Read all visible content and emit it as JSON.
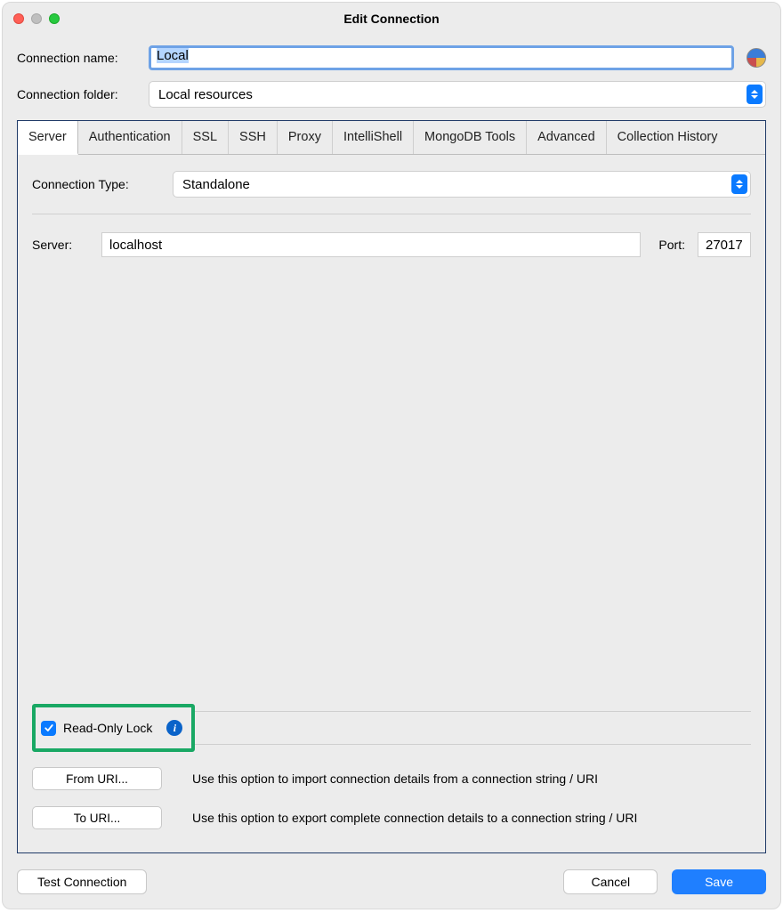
{
  "window": {
    "title": "Edit Connection"
  },
  "form": {
    "name_label": "Connection name:",
    "name_value": "Local",
    "folder_label": "Connection folder:",
    "folder_value": "Local resources"
  },
  "tabs": {
    "server": "Server",
    "authentication": "Authentication",
    "ssl": "SSL",
    "ssh": "SSH",
    "proxy": "Proxy",
    "intellishell": "IntelliShell",
    "mongodb_tools": "MongoDB Tools",
    "advanced": "Advanced",
    "collection_history": "Collection History"
  },
  "server_tab": {
    "ctype_label": "Connection Type:",
    "ctype_value": "Standalone",
    "server_label": "Server:",
    "server_value": "localhost",
    "port_label": "Port:",
    "port_value": "27017",
    "readonly_label": "Read-Only Lock",
    "readonly_checked": true,
    "from_uri_btn": "From URI...",
    "from_uri_desc": "Use this option to import connection details from a connection string / URI",
    "to_uri_btn": "To URI...",
    "to_uri_desc": "Use this option to export complete connection details to a connection string / URI"
  },
  "buttons": {
    "test": "Test Connection",
    "cancel": "Cancel",
    "save": "Save"
  },
  "info_glyph": "i"
}
